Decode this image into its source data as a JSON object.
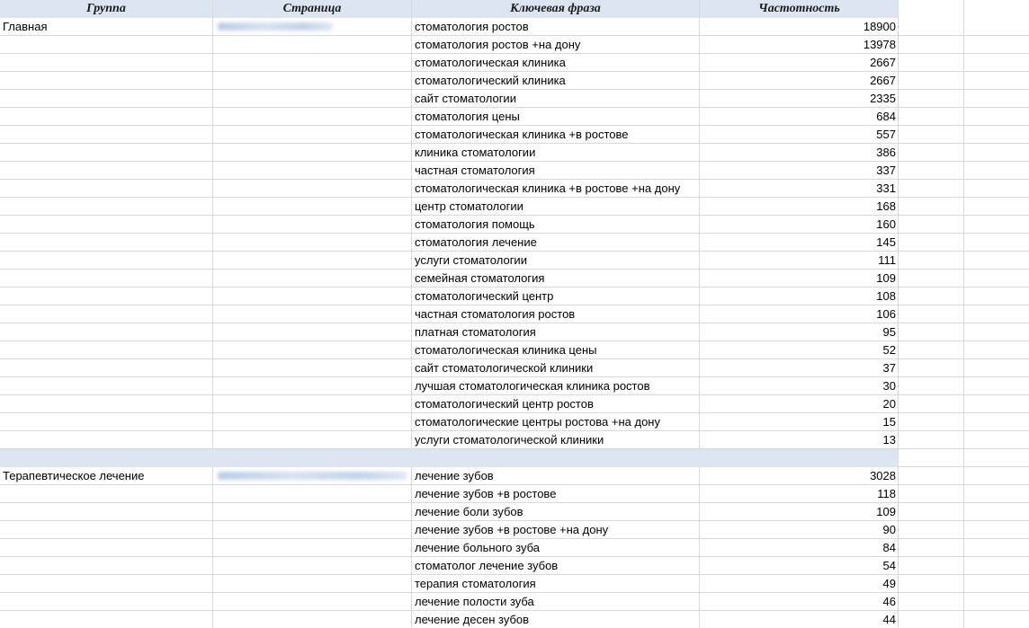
{
  "header": {
    "col_group": "Группа",
    "col_page": "Страница",
    "col_phrase": "Ключевая фраза",
    "col_freq": "Частотность"
  },
  "groups": [
    {
      "name": "Главная",
      "rows": [
        {
          "phrase": "стоматология ростов",
          "freq": "18900"
        },
        {
          "phrase": "стоматология ростов +на дону",
          "freq": "13978"
        },
        {
          "phrase": "стоматологическая клиника",
          "freq": "2667"
        },
        {
          "phrase": "стоматологический клиника",
          "freq": "2667"
        },
        {
          "phrase": "сайт стоматологии",
          "freq": "2335"
        },
        {
          "phrase": "стоматология цены",
          "freq": "684"
        },
        {
          "phrase": "стоматологическая клиника +в ростове",
          "freq": "557"
        },
        {
          "phrase": "клиника стоматологии",
          "freq": "386"
        },
        {
          "phrase": "частная стоматология",
          "freq": "337"
        },
        {
          "phrase": "стоматологическая клиника +в ростове +на дону",
          "freq": "331"
        },
        {
          "phrase": "центр стоматологии",
          "freq": "168"
        },
        {
          "phrase": "стоматология помощь",
          "freq": "160"
        },
        {
          "phrase": "стоматология лечение",
          "freq": "145"
        },
        {
          "phrase": "услуги стоматологии",
          "freq": "111"
        },
        {
          "phrase": "семейная стоматология",
          "freq": "109"
        },
        {
          "phrase": "стоматологический центр",
          "freq": "108"
        },
        {
          "phrase": "частная стоматология ростов",
          "freq": "106"
        },
        {
          "phrase": "платная стоматология",
          "freq": "95"
        },
        {
          "phrase": "стоматологическая клиника цены",
          "freq": "52"
        },
        {
          "phrase": "сайт стоматологической клиники",
          "freq": "37"
        },
        {
          "phrase": "лучшая стоматологическая клиника ростов",
          "freq": "30"
        },
        {
          "phrase": "стоматологический центр ростов",
          "freq": "20"
        },
        {
          "phrase": "стоматологические центры ростова +на дону",
          "freq": "15"
        },
        {
          "phrase": "услуги стоматологической клиники",
          "freq": "13"
        }
      ]
    },
    {
      "name": "Терапевтическое лечение",
      "rows": [
        {
          "phrase": "лечение зубов",
          "freq": "3028"
        },
        {
          "phrase": "лечение зубов +в ростове",
          "freq": "118"
        },
        {
          "phrase": "лечение боли зубов",
          "freq": "109"
        },
        {
          "phrase": "лечение зубов +в ростове +на дону",
          "freq": "90"
        },
        {
          "phrase": "лечение больного зуба",
          "freq": "84"
        },
        {
          "phrase": "стоматолог лечение зубов",
          "freq": "54"
        },
        {
          "phrase": "терапия стоматология",
          "freq": "49"
        },
        {
          "phrase": "лечение полости зуба",
          "freq": "46"
        },
        {
          "phrase": "лечение десен зубов",
          "freq": "44"
        }
      ]
    }
  ]
}
